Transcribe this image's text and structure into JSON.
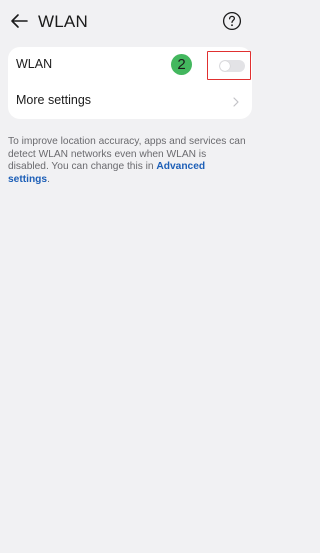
{
  "header": {
    "back_icon": "arrow-left-icon",
    "title": "WLAN",
    "help_icon": "question-circle-icon"
  },
  "wlan_row": {
    "label": "WLAN",
    "badge": "2",
    "badge_color": "#43b75e",
    "toggle_state": "off",
    "highlight_color": "#e03030"
  },
  "more_row": {
    "label": "More settings",
    "chevron_icon": "chevron-right-icon"
  },
  "description": {
    "text": "To improve location accuracy, apps and services can detect WLAN networks even when WLAN is disabled. You can change this in ",
    "link": "Advanced settings",
    "suffix": ".",
    "link_color": "#1d5fb7"
  },
  "background_color": "#f1f1f3"
}
